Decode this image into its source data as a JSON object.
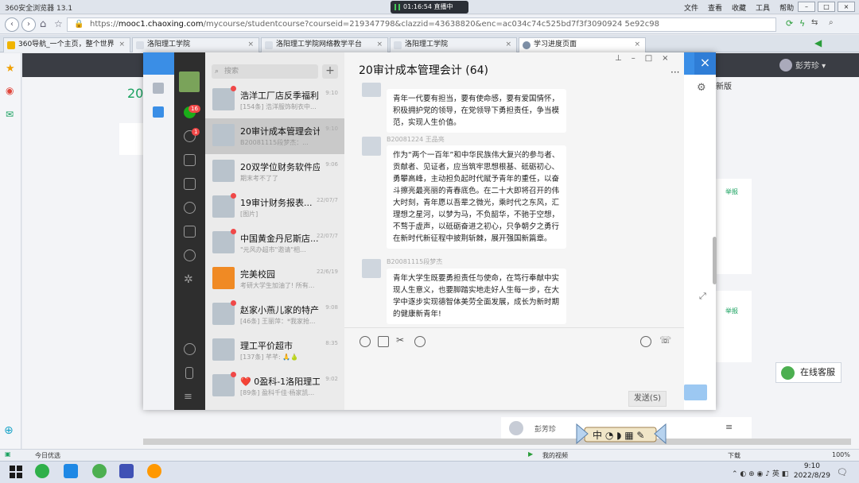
{
  "browser": {
    "title": "360安全浏览器 13.1",
    "live_timer": "01:16:54",
    "live_label": "直播中",
    "menus": [
      "文件",
      "查看",
      "收藏",
      "工具",
      "帮助"
    ],
    "url_prefix": "https://",
    "url_host": "mooc1.chaoxing.com",
    "url_path": "/mycourse/studentcourse?courseid=219347798&clazzid=43638820&enc=ac034c74c525bd7f3f3090924 5e92c98",
    "tabs": [
      "360导航_一个主页，整个世界",
      "洛阳理工学院",
      "洛阳理工学院网络教学平台",
      "洛阳理工学院",
      "学习进度页面"
    ]
  },
  "page": {
    "username": "彭芳珍",
    "edition_label": "新版",
    "online_service": "在线客服",
    "report_label": "举报",
    "bottom_name": "彭芳珍"
  },
  "chat": {
    "search_placeholder": "搜索",
    "title": "20审计成本管理会计 (64)",
    "send_label": "发送(S)",
    "conversations": [
      {
        "name": "浩洋工厂店反季福利...",
        "preview": "[154条] 浩洋服饰制衣中...",
        "time": "9:10",
        "unread": true
      },
      {
        "name": "20审计成本管理会计",
        "preview": "B20081115段梦杰：...",
        "time": "9:10",
        "unread": false
      },
      {
        "name": "20双学位财务软件应用",
        "preview": "期末考不了了",
        "time": "9:06",
        "unread": false
      },
      {
        "name": "19审计财务报表...",
        "preview": "[图片]",
        "time": "22/07/7",
        "unread": true
      },
      {
        "name": "中国黄金丹尼斯店...",
        "preview": "\"元风办超市\"邀请\"相...",
        "time": "22/07/7",
        "unread": true
      },
      {
        "name": "完美校园",
        "preview": "考研大学生加油了! 所有...",
        "time": "22/6/19",
        "unread": false
      },
      {
        "name": "赵家小燕儿家的特产",
        "preview": "[46条] 王丽萍：*我家抢...",
        "time": "9:08",
        "unread": true
      },
      {
        "name": "理工平价超市",
        "preview": "[137条] 芊芊: 🙏🍐",
        "time": "8:35",
        "unread": false
      },
      {
        "name": "❤️ 0盈科-1洛阳理工...",
        "preview": "[89条] 盈科千佳·杨家凯...",
        "time": "9:02",
        "unread": true
      }
    ],
    "badges": {
      "chat": "16",
      "contacts": "1"
    },
    "messages": [
      {
        "sender": "",
        "text": "青年一代要有担当，要有使命感，要有爱国情怀，积极拥护党的领导，在党领导下勇担责任，争当模范，实现人生价值。"
      },
      {
        "sender": "B20081224 王品亮",
        "text": "作为“两个一百年”和中华民族伟大复兴的参与者、贡献者、见证者，应当筑牢思想根基、砥砺初心、勇攀高峰，主动担负起时代赋予青年的重任，以奋斗擦亮最亮丽的青春底色。在二十大即将召开的伟大时刻，青年愿以吾辈之微光，乘时代之东风，汇理想之星河，以梦为马，不负韶华，不驰于空想，不骛于虚声，以砥砺奋进之初心，只争朝夕之勇行在新时代新征程中披荆斩棘，展开强国新篇章。"
      },
      {
        "sender": "B20081115段梦杰",
        "text": "青年大学生既要勇担责任与使命，在笃行奉献中实现人生意义，也要脚踏实地走好人生每一步，在大学中逐步实现德智体美劳全面发展，成长为新时期的健康新青年!"
      }
    ]
  },
  "statusbar": {
    "left": "今日优选",
    "video": "我的视频",
    "download": "下载",
    "zoom": "100%"
  },
  "taskbar": {
    "time": "9:10",
    "date": "2022/8/29"
  },
  "colors": {
    "accent": "#3a8ee6",
    "chat_sidebar": "#2e2e2e",
    "badge": "#f04848",
    "green": "#1aa260"
  }
}
